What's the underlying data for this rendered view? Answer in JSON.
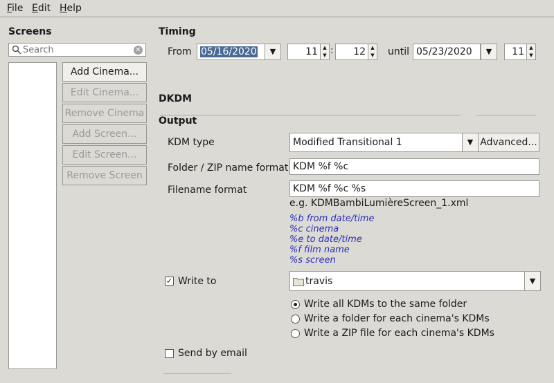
{
  "menu": {
    "file": "File",
    "edit": "Edit",
    "help": "Help",
    "file_rest": "ile",
    "edit_rest": "dit",
    "help_rest": "elp",
    "file_u": "F",
    "edit_u": "E",
    "help_u": "H"
  },
  "screens": {
    "title": "Screens",
    "search_placeholder": "Search",
    "buttons": {
      "add_cinema": "Add Cinema...",
      "edit_cinema": "Edit Cinema...",
      "remove_cinema": "Remove Cinema",
      "add_screen": "Add Screen...",
      "edit_screen": "Edit Screen...",
      "remove_screen": "Remove Screen"
    }
  },
  "timing": {
    "title": "Timing",
    "from_label": "From",
    "from_date": "05/16/2020",
    "from_hour": "11",
    "from_minute": "12",
    "until_label": "until",
    "until_date": "05/23/2020",
    "until_hour": "11",
    "colon": ":"
  },
  "dkdm": {
    "title": "DKDM"
  },
  "output": {
    "title": "Output",
    "kdm_type_label": "KDM type",
    "kdm_type_value": "Modified Transitional 1",
    "advanced_button": "Advanced...",
    "folder_format_label": "Folder / ZIP name format",
    "folder_format_value": "KDM %f %c",
    "filename_format_label": "Filename format",
    "filename_format_value": "KDM %f %c %s",
    "example": "e.g. KDMBambiLumièreScreen_1.xml",
    "hints": [
      "%b from date/time",
      "%c cinema",
      "%e to date/time",
      "%f film name",
      "%s screen"
    ],
    "write_to_label": "Write to",
    "write_to_checked": true,
    "write_to_folder": "travis",
    "radio_same_folder": "Write all KDMs to the same folder",
    "radio_folder_each": "Write a folder for each cinema's KDMs",
    "radio_zip_each": "Write a ZIP file for each cinema's KDMs",
    "send_email_label": "Send by email",
    "send_email_checked": false
  },
  "colors": {
    "selection": "#4a6a94",
    "hint": "#2b2fb8",
    "background": "#dcdad5"
  }
}
